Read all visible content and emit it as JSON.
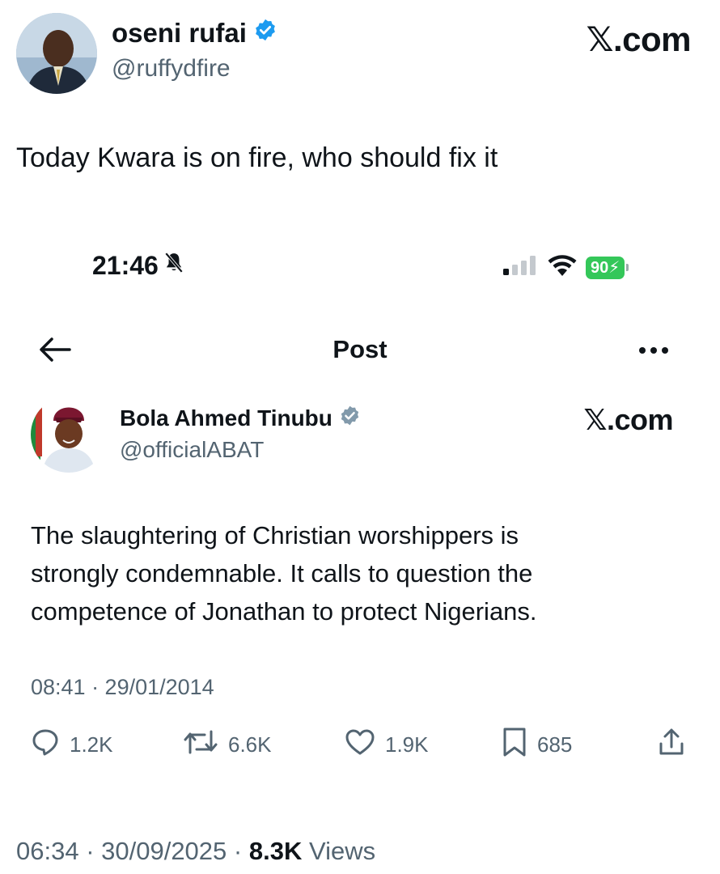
{
  "outer_tweet": {
    "author_name": "oseni rufai",
    "author_handle": "@ruffydfire",
    "brand": "𝕏.com",
    "text": "Today Kwara is on fire, who should fix it",
    "timestamp": "06:34 · 30/09/2025 ·",
    "views_count": "8.3K",
    "views_label": "Views"
  },
  "phone_status": {
    "time": "21:46",
    "battery": "90"
  },
  "post_nav": {
    "title": "Post"
  },
  "quoted_post": {
    "author_name": "Bola Ahmed Tinubu",
    "author_handle": "@officialABAT",
    "brand": "𝕏.com",
    "lines": [
      "The slaughtering of Christian worshippers  is",
      "strongly condemnable. It calls to question the",
      "competence of Jonathan to protect Nigerians."
    ],
    "timestamp": "08:41 · 29/01/2014",
    "actions": {
      "replies": "1.2K",
      "reposts": "6.6K",
      "likes": "1.9K",
      "bookmarks": "685"
    }
  },
  "colors": {
    "verified_blue": "#1d9bf0",
    "verified_gray": "#829aab",
    "battery_green": "#34c759",
    "secondary_text": "#536471"
  }
}
